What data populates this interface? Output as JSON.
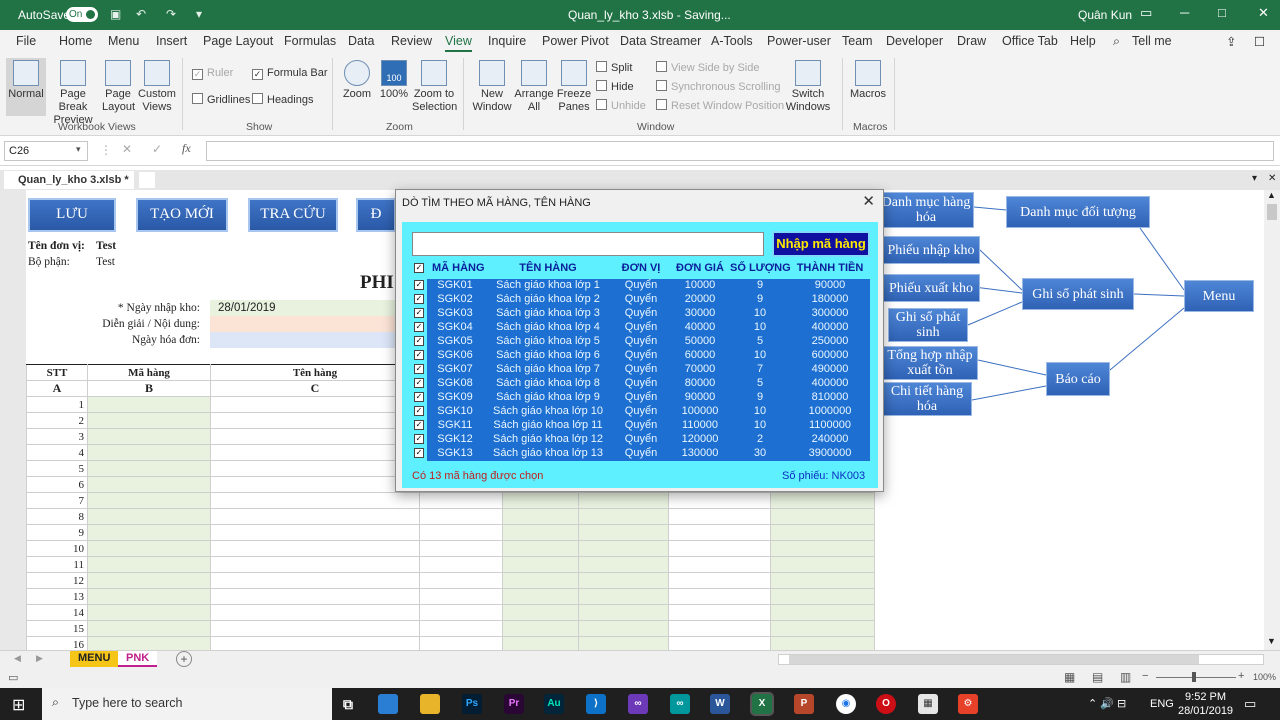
{
  "titlebar": {
    "autosave_label": "AutoSave",
    "autosave_state": "On",
    "doc_title": "Quan_ly_kho 3.xlsb - Saving...",
    "user": "Quân Kun"
  },
  "menu_tabs": [
    "File",
    "Home",
    "Menu",
    "Insert",
    "Page Layout",
    "Formulas",
    "Data",
    "Review",
    "View",
    "Inquire",
    "Power Pivot",
    "Data Streamer",
    "A-Tools",
    "Power-user",
    "Team",
    "Developer",
    "Draw",
    "Office Tab",
    "Help",
    "Tell me"
  ],
  "ribbon": {
    "workbook_views": [
      "Normal",
      "Page Break Preview",
      "Page Layout",
      "Custom Views"
    ],
    "workbook_views_label": "Workbook Views",
    "show": {
      "ruler": "Ruler",
      "formula_bar": "Formula Bar",
      "gridlines": "Gridlines",
      "headings": "Headings",
      "label": "Show"
    },
    "zoom": {
      "zoom": "Zoom",
      "zoom100": "100%",
      "zoom_sel": "Zoom to Selection",
      "label": "Zoom",
      "badge": "100"
    },
    "window": {
      "new": "New Window",
      "arrange": "Arrange All",
      "freeze": "Freeze Panes",
      "split": "Split",
      "hide": "Hide",
      "unhide": "Unhide",
      "side": "View Side by Side",
      "sync": "Synchronous Scrolling",
      "reset": "Reset Window Position",
      "switch": "Switch Windows",
      "label": "Window"
    },
    "macros": {
      "macros": "Macros",
      "label": "Macros"
    }
  },
  "formula": {
    "namebox": "C26",
    "fx": "fx"
  },
  "workbook_tab": "Quan_ly_kho 3.xlsb *",
  "sheet": {
    "buttons": [
      "LƯU",
      "TẠO MỚI",
      "TRA CỨU",
      "Đ"
    ],
    "unit_label": "Tên đơn vị:",
    "unit_value": "Test",
    "dept_label": "Bộ phận:",
    "dept_value": "Test",
    "title_partial": "PHI",
    "date_label": "*  Ngày nhập kho:",
    "date_value": "28/01/2019",
    "desc_label": "Diễn giải / Nội dung:",
    "invoice_label": "Ngày hóa đơn:",
    "headers": [
      "STT",
      "Mã hàng",
      "Tên hàng"
    ],
    "subheaders": [
      "A",
      "B",
      "C"
    ],
    "rows": [
      "1",
      "2",
      "3",
      "4",
      "5",
      "6",
      "7",
      "8",
      "9",
      "10",
      "11",
      "12",
      "13",
      "14",
      "15",
      "16"
    ]
  },
  "diagram": {
    "danh_muc_hang_hoa": "Danh mục hàng hóa",
    "danh_muc_doi_tuong": "Danh mục đối tượng",
    "phieu_nhap_kho": "Phiếu nhập kho",
    "phieu_xuat_kho": "Phiếu xuất kho",
    "ghi_so_phat_sinh": "Ghi sổ phát sinh",
    "ghi_so_phat_sinh_small": "Ghi sổ phát sinh",
    "menu": "Menu",
    "tong_hop": "Tổng hợp nhập xuất tồn",
    "bao_cao": "Báo cáo",
    "chi_tiet": "Chi tiết hàng hóa"
  },
  "sheet_tabs": [
    "MENU",
    "PNK"
  ],
  "status": {
    "zoom": "100%"
  },
  "taskbar": {
    "search": "Type here to search",
    "lang": "ENG",
    "time": "9:52 PM",
    "date": "28/01/2019"
  },
  "dialog": {
    "title": "DÒ TÌM THEO MÃ HÀNG, TÊN HÀNG",
    "search_value": "",
    "button": "Nhập mã hàng",
    "columns": [
      "MÃ HÀNG",
      "TÊN HÀNG",
      "ĐƠN VỊ",
      "ĐƠN GIÁ",
      "SỐ LƯỢNG",
      "THÀNH TIỀN"
    ],
    "items": [
      {
        "code": "SGK01",
        "name": "Sách giáo khoa lớp 1",
        "unit": "Quyển",
        "price": "10000",
        "qty": "9",
        "total": "90000"
      },
      {
        "code": "SGK02",
        "name": "Sách giáo khoa lớp 2",
        "unit": "Quyển",
        "price": "20000",
        "qty": "9",
        "total": "180000"
      },
      {
        "code": "SGK03",
        "name": "Sách giáo khoa lớp 3",
        "unit": "Quyển",
        "price": "30000",
        "qty": "10",
        "total": "300000"
      },
      {
        "code": "SGK04",
        "name": "Sách giáo khoa lớp 4",
        "unit": "Quyển",
        "price": "40000",
        "qty": "10",
        "total": "400000"
      },
      {
        "code": "SGK05",
        "name": "Sách giáo khoa lớp 5",
        "unit": "Quyển",
        "price": "50000",
        "qty": "5",
        "total": "250000"
      },
      {
        "code": "SGK06",
        "name": "Sách giáo khoa lớp 6",
        "unit": "Quyển",
        "price": "60000",
        "qty": "10",
        "total": "600000"
      },
      {
        "code": "SGK07",
        "name": "Sách giáo khoa lớp 7",
        "unit": "Quyển",
        "price": "70000",
        "qty": "7",
        "total": "490000"
      },
      {
        "code": "SGK08",
        "name": "Sách giáo khoa lớp 8",
        "unit": "Quyển",
        "price": "80000",
        "qty": "5",
        "total": "400000"
      },
      {
        "code": "SGK09",
        "name": "Sách giáo khoa lớp 9",
        "unit": "Quyển",
        "price": "90000",
        "qty": "9",
        "total": "810000"
      },
      {
        "code": "SGK10",
        "name": "Sách giáo khoa lớp 10",
        "unit": "Quyển",
        "price": "100000",
        "qty": "10",
        "total": "1000000"
      },
      {
        "code": "SGK11",
        "name": "Sách giáo khoa lớp 11",
        "unit": "Quyển",
        "price": "110000",
        "qty": "10",
        "total": "1100000"
      },
      {
        "code": "SGK12",
        "name": "Sách giáo khoa lớp 12",
        "unit": "Quyển",
        "price": "120000",
        "qty": "2",
        "total": "240000"
      },
      {
        "code": "SGK13",
        "name": "Sách giáo khoa lớp 13",
        "unit": "Quyển",
        "price": "130000",
        "qty": "30",
        "total": "3900000"
      }
    ],
    "footer_count": "Có 13 mã hàng được chọn",
    "footer_voucher": "Số phiếu: NK003"
  }
}
